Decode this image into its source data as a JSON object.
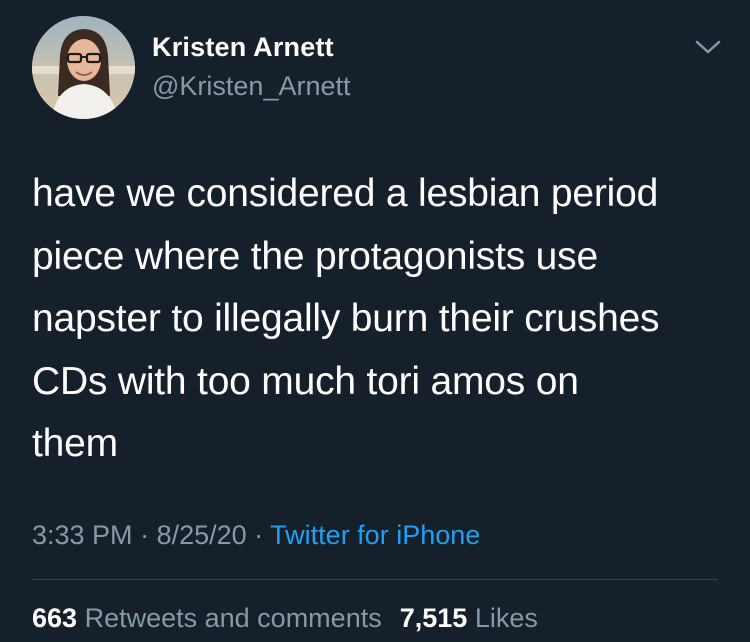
{
  "tweet": {
    "author": {
      "display_name": "Kristen Arnett",
      "handle": "@Kristen_Arnett"
    },
    "text": "have we considered a lesbian period\npiece where the protagonists use\nnapster to illegally burn their crushes\nCDs with too much tori amos on\nthem",
    "time": "3:33 PM",
    "separator": " · ",
    "date": "8/25/20",
    "source": "Twitter for iPhone",
    "retweets_count": "663",
    "retweets_label": "Retweets and comments",
    "likes_count": "7,515",
    "likes_label": "Likes"
  },
  "icons": {
    "menu": "chevron-down-icon",
    "avatar": "profile-photo"
  },
  "colors": {
    "background": "#15202b",
    "primary_text": "#ffffff",
    "secondary_text": "#8899a6",
    "link": "#1da1f2",
    "divider": "#38444d"
  }
}
